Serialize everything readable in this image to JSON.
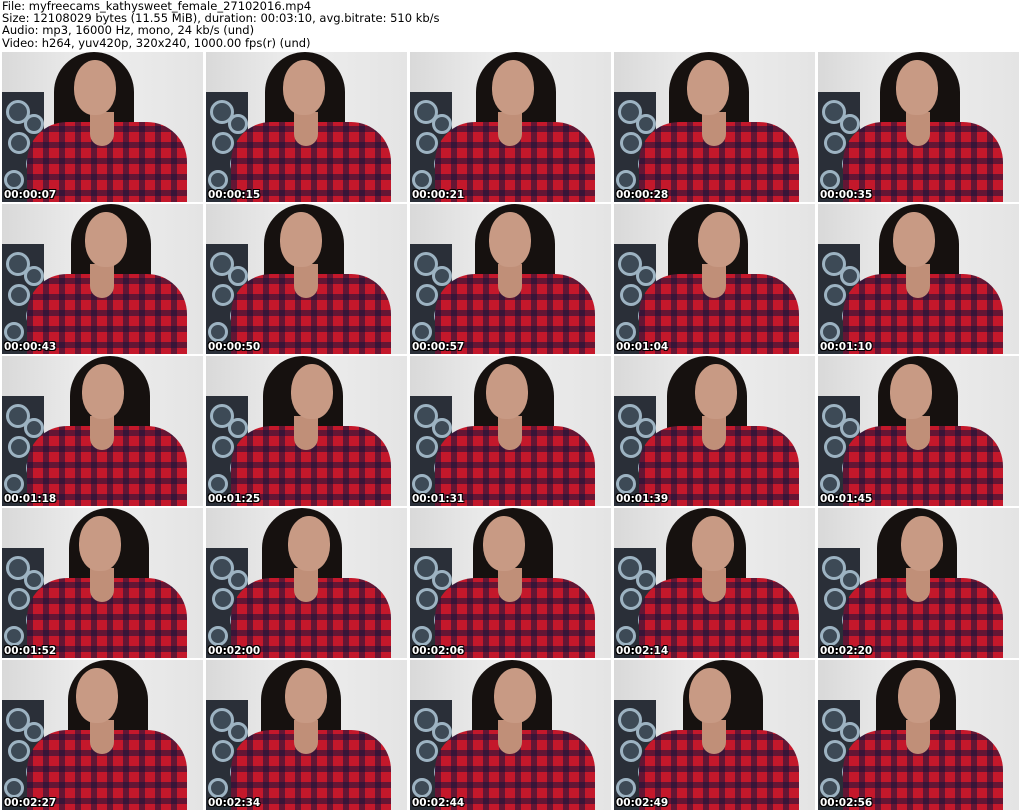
{
  "header": {
    "file": "File: myfreecams_kathysweet_female_27102016.mp4",
    "size": "Size: 12108029 bytes (11.55 MiB), duration: 00:03:10, avg.bitrate: 510 kb/s",
    "audio": "Audio: mp3, 16000 Hz, mono, 24 kb/s (und)",
    "video": "Video: h264, yuv420p, 320x240, 1000.00 fps(r) (und)"
  },
  "thumbnails": [
    {
      "timestamp": "00:00:07"
    },
    {
      "timestamp": "00:00:15"
    },
    {
      "timestamp": "00:00:21"
    },
    {
      "timestamp": "00:00:28"
    },
    {
      "timestamp": "00:00:35"
    },
    {
      "timestamp": "00:00:43"
    },
    {
      "timestamp": "00:00:50"
    },
    {
      "timestamp": "00:00:57"
    },
    {
      "timestamp": "00:01:04"
    },
    {
      "timestamp": "00:01:10"
    },
    {
      "timestamp": "00:01:18"
    },
    {
      "timestamp": "00:01:25"
    },
    {
      "timestamp": "00:01:31"
    },
    {
      "timestamp": "00:01:39"
    },
    {
      "timestamp": "00:01:45"
    },
    {
      "timestamp": "00:01:52"
    },
    {
      "timestamp": "00:02:00"
    },
    {
      "timestamp": "00:02:06"
    },
    {
      "timestamp": "00:02:14"
    },
    {
      "timestamp": "00:02:20"
    },
    {
      "timestamp": "00:02:27"
    },
    {
      "timestamp": "00:02:34"
    },
    {
      "timestamp": "00:02:44"
    },
    {
      "timestamp": "00:02:49"
    },
    {
      "timestamp": "00:02:56"
    }
  ]
}
